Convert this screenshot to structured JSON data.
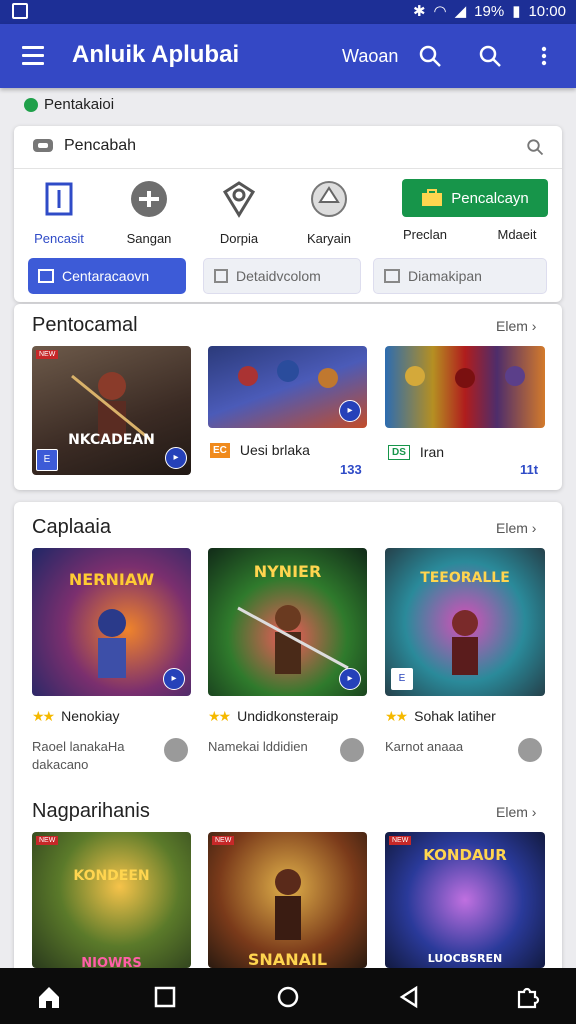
{
  "status": {
    "battery": "19%",
    "time": "10:00"
  },
  "appbar": {
    "title": "Anluik Aplubai",
    "action_label": "Waoan"
  },
  "subheader": {
    "label": "Pentakaioi"
  },
  "search": {
    "placeholder": "Pencabah"
  },
  "quick_categories": [
    "Pencasit",
    "Sangan",
    "Dorpia",
    "Karyain",
    "Preclan",
    "Mdaeit"
  ],
  "green_button": {
    "label": "Pencalcayn"
  },
  "tabs": [
    "Centaracaovn",
    "Detaidvcolom",
    "Diamakipan"
  ],
  "sections": [
    {
      "title": "Pentocamal",
      "see_more": "Elem",
      "items": [
        {
          "art_text": "NKCADEAN",
          "meta_icon": "EC",
          "meta": "",
          "count": ""
        },
        {
          "art_text": "",
          "meta_icon": "EC",
          "meta": "Uesi brlaka",
          "count": "133"
        },
        {
          "art_text": "",
          "meta_icon": "DS",
          "meta": "Iran",
          "count": "11t"
        }
      ]
    },
    {
      "title": "Caplaaia",
      "see_more": "Elem",
      "items": [
        {
          "art_text": "NERNIAW",
          "title": "Nenokiay",
          "desc": "Raoel lanakaHa dakacano"
        },
        {
          "art_text": "NYNIER",
          "title": "Undidkonsteraip",
          "desc": "Namekai lddidien"
        },
        {
          "art_text": "TEEORALLE",
          "title": "Sohak latiher",
          "desc": "Karnot anaaa"
        }
      ]
    },
    {
      "title": "Nagparihanis",
      "see_more": "Elem",
      "items": [
        {
          "art_text": "KONDEEN",
          "sub_text": "NIOWRS"
        },
        {
          "art_text": "SNANAIL",
          "sub_text": ""
        },
        {
          "art_text": "KONDAUR",
          "sub_text": "LUOCBSREN"
        }
      ]
    }
  ],
  "colors": {
    "appbar": "#3448c5",
    "statusbar": "#1d2f96",
    "accent": "#2f4bc7",
    "green": "#17954a"
  }
}
